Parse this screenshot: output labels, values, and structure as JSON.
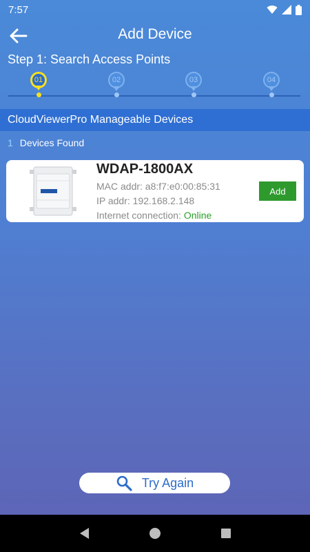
{
  "status_bar": {
    "time": "7:57",
    "icons": [
      "wifi-icon",
      "signal-icon",
      "battery-icon"
    ]
  },
  "app_bar": {
    "title": "Add Device",
    "back_icon": "arrow-left-icon"
  },
  "step_title": "Step 1: Search Access Points",
  "stepper": {
    "steps": [
      {
        "label": "01",
        "active": true
      },
      {
        "label": "02",
        "active": false
      },
      {
        "label": "03",
        "active": false
      },
      {
        "label": "04",
        "active": false
      }
    ]
  },
  "section_header": "CloudViewerPro Manageable Devices",
  "found": {
    "count": "1",
    "label": "Devices Found"
  },
  "devices": [
    {
      "name": "WDAP-1800AX",
      "mac": "MAC addr: a8:f7:e0:00:85:31",
      "ip": "IP addr: 192.168.2.148",
      "internet_label": "Internet connection: ",
      "internet_status": "Online",
      "add_label": "Add"
    }
  ],
  "try_again": {
    "label": "Try Again",
    "icon": "search-icon"
  },
  "nav": {
    "back_icon": "nav-back-icon",
    "home_icon": "nav-home-icon",
    "recents_icon": "nav-recents-icon"
  },
  "colors": {
    "accent": "#2d6cc9",
    "active_step": "#f5e020",
    "section_bg": "#2f6fd3",
    "add_button": "#2e9a2e",
    "online": "#2aa02a"
  }
}
